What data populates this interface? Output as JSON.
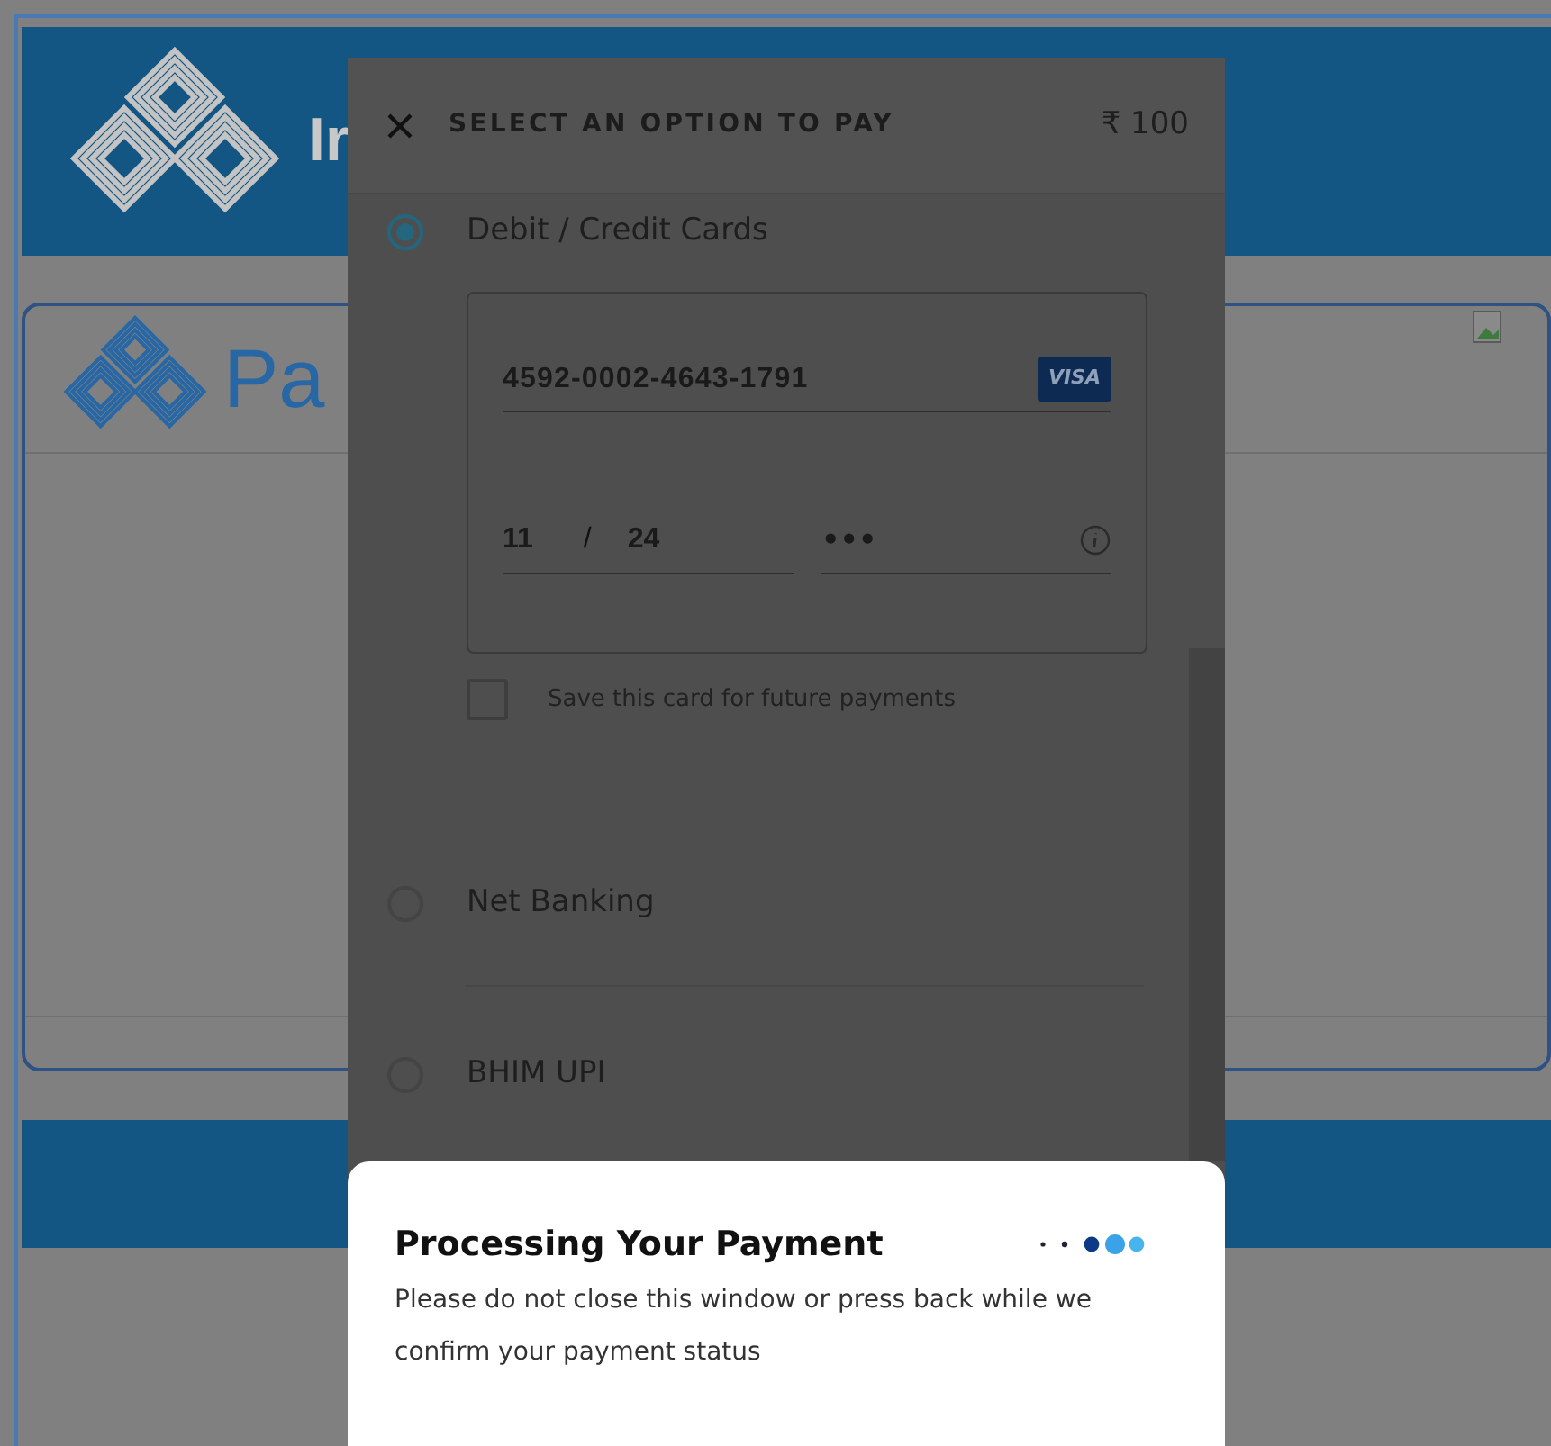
{
  "page": {
    "header_title": "Ir",
    "card_title": "Pa"
  },
  "modal": {
    "title": "SELECT AN OPTION TO PAY",
    "amount": "₹ 100",
    "options": [
      {
        "label": "Debit / Credit Cards",
        "selected": true
      },
      {
        "label": "Net Banking",
        "selected": false
      },
      {
        "label": "BHIM UPI",
        "selected": false
      }
    ],
    "card_form": {
      "number": "4592-0002-4643-1791",
      "brand": "VISA",
      "expiry_month": "11",
      "expiry_separator": "/",
      "expiry_year": "24",
      "cvv": "•••",
      "save_card": {
        "label": "Save this card for future payments",
        "checked": false
      }
    }
  },
  "processing": {
    "title": "Processing Your Payment",
    "message": "Please do not close this window or press back while we confirm your payment status"
  }
}
